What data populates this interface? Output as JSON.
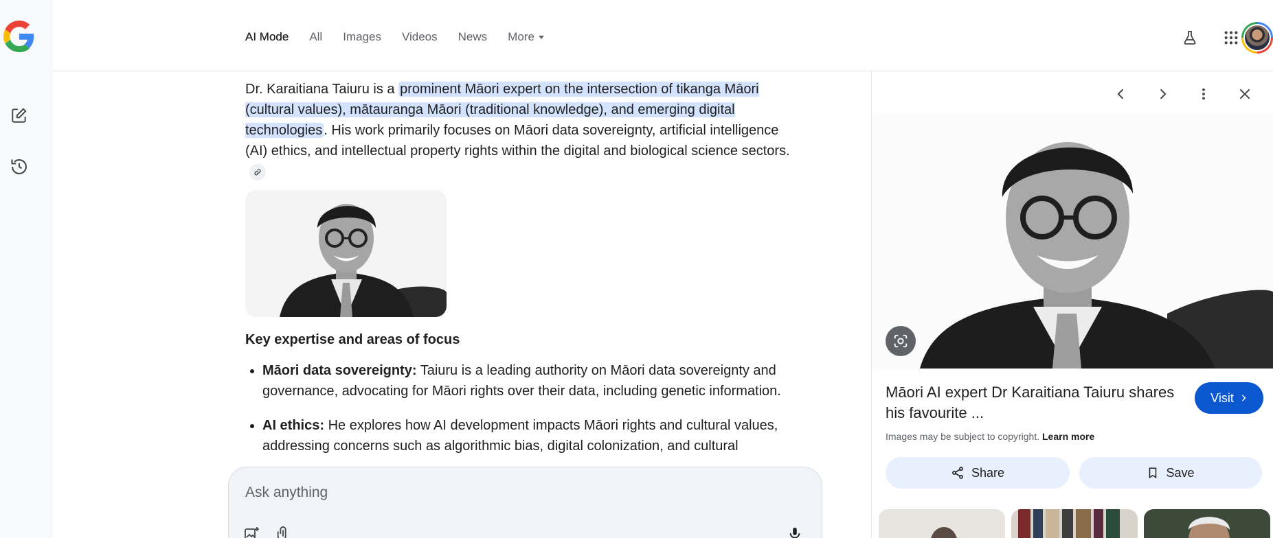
{
  "header": {
    "tabs": [
      {
        "label": "AI Mode",
        "active": true
      },
      {
        "label": "All"
      },
      {
        "label": "Images"
      },
      {
        "label": "Videos"
      },
      {
        "label": "News"
      },
      {
        "label": "More"
      }
    ],
    "icons": [
      "labs-flask-icon",
      "apps-grid-icon",
      "account-avatar"
    ]
  },
  "rail": {
    "icons": [
      "google-logo",
      "new-chat-icon",
      "history-icon"
    ]
  },
  "main": {
    "intro_before": "Dr. Karaitiana Taiuru is a ",
    "intro_highlight": "prominent Māori expert on the intersection of tikanga Māori (cultural values), mātauranga Māori (traditional knowledge), and emerging digital technologies",
    "intro_after": ". His work primarily focuses on Māori data sovereignty, artificial intelligence (AI) ethics, and intellectual property rights within the digital and biological science sectors.",
    "heading": "Key expertise and areas of focus",
    "bullets": [
      {
        "title": "Māori data sovereignty:",
        "text": " Taiuru is a leading authority on Māori data sovereignty and governance, advocating for Māori rights over their data, including genetic information."
      },
      {
        "title": "AI ethics:",
        "text": " He explores how AI development impacts Māori rights and cultural values, addressing concerns such as algorithmic bias, digital colonization, and cultural"
      }
    ]
  },
  "ask": {
    "placeholder": "Ask anything"
  },
  "panel": {
    "title": "Māori AI expert Dr Karaitiana Taiuru shares his favourite ...",
    "visit_label": "Visit",
    "copyright_text": "Images may be subject to copyright.",
    "learn_more": "Learn more",
    "share_label": "Share",
    "save_label": "Save"
  },
  "colors": {
    "accent": "#0b57d0",
    "highlight": "#d3e3fd",
    "pill_bg": "#e8f0fe",
    "rail_bg": "#f8f9fa"
  }
}
